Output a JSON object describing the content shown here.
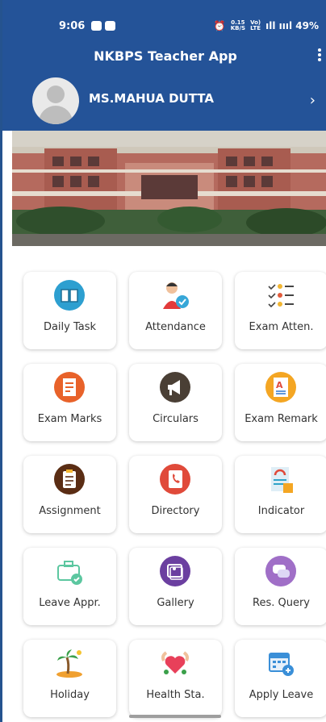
{
  "status_bar": {
    "time": "9:06",
    "right_text": "ıll ıııl 49%",
    "speed_top": "0.15",
    "speed_bottom": "KB/S",
    "volte_top": "Vo)",
    "volte_bottom": "LTE"
  },
  "app_bar": {
    "title": "NKBPS Teacher App",
    "menu_icon": "more-vert-icon"
  },
  "profile": {
    "name": "MS.MAHUA DUTTA",
    "arrow": "›"
  },
  "banner": {
    "image": "school-building-photo"
  },
  "tiles": [
    {
      "label": "Daily Task",
      "icon": "book-icon",
      "color": "#2d9fd0"
    },
    {
      "label": "Attendance",
      "icon": "teacher-check-icon",
      "color": "#37a7d8"
    },
    {
      "label": "Exam Atten.",
      "icon": "checklist-icon",
      "color": "#f2b632"
    },
    {
      "label": "Exam Marks",
      "icon": "report-icon",
      "color": "#e8622a"
    },
    {
      "label": "Circulars",
      "icon": "megaphone-icon",
      "color": "#4a3f35"
    },
    {
      "label": "Exam Remark",
      "icon": "grade-a-icon",
      "color": "#f4a623"
    },
    {
      "label": "Assignment",
      "icon": "clipboard-icon",
      "color": "#5a2d14"
    },
    {
      "label": "Directory",
      "icon": "phonebook-icon",
      "color": "#e04a3a"
    },
    {
      "label": "Indicator",
      "icon": "indicator-icon",
      "color": "#2fa3c8"
    },
    {
      "label": "Leave Appr.",
      "icon": "briefcase-check-icon",
      "color": "#5cc7a0"
    },
    {
      "label": "Gallery",
      "icon": "gallery-icon",
      "color": "#6b3fa0"
    },
    {
      "label": "Res. Query",
      "icon": "chat-query-icon",
      "color": "#7b6fd8"
    },
    {
      "label": "Holiday",
      "icon": "beach-icon",
      "color": "#f0a030"
    },
    {
      "label": "Health Sta.",
      "icon": "health-icon",
      "color": "#e8405a"
    },
    {
      "label": "Apply Leave",
      "icon": "calendar-leave-icon",
      "color": "#3a8fd8"
    }
  ]
}
